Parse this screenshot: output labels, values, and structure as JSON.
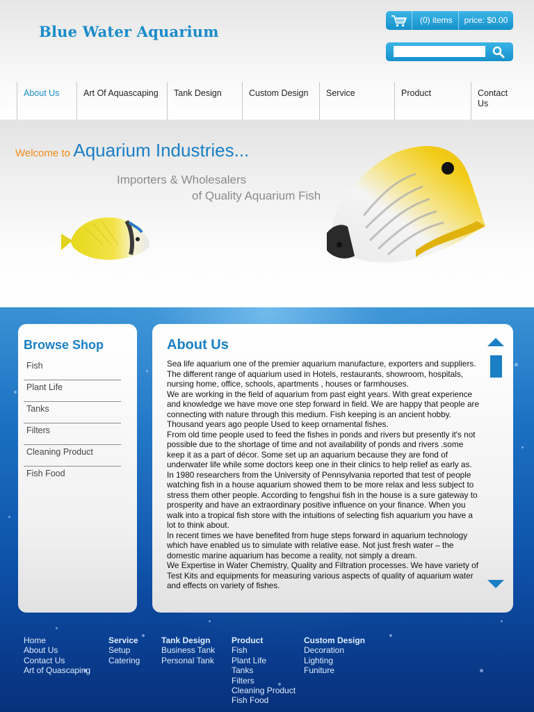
{
  "site": {
    "logo": "Blue Water Aquarium"
  },
  "cart": {
    "items": "(0) items",
    "price": "price: $0.00"
  },
  "search": {
    "placeholder": ""
  },
  "nav": [
    "About Us",
    "Art Of Aquascaping",
    "Tank Design",
    "Custom Design",
    "Service",
    "Product",
    "Contact Us"
  ],
  "banner": {
    "welcome": "Welcome to",
    "company": "Aquarium Industries...",
    "tagline1": "Importers & Wholesalers",
    "tagline2": "of Quality Aquarium Fish"
  },
  "sidebar": {
    "title": "Browse Shop",
    "items": [
      "Fish",
      "Plant Life",
      "Tanks",
      "Filters",
      "Cleaning Product",
      "Fish Food"
    ]
  },
  "about": {
    "title": "About Us",
    "paragraphs": [
      "Sea life aquarium one of the premier aquarium manufacture, exporters and suppliers. The different range of aquarium used in Hotels, restaurants, showroom, hospitals, nursing home, office, schools, apartments , houses or farmhouses.",
      "We are working in the field of aquarium from past eight years. With great experience and knowledge we have move one step forward in field. We are happy that people are connecting with nature through this medium. Fish keeping is an ancient hobby. Thousand years ago people Used to keep ornamental fishes.",
      "From old time people used to feed the fishes in ponds and rivers but presently it's not possible due to the shortage of time and not availability of ponds and rivers .some keep it as a part of décor. Some set up an aquarium because they are fond of underwater life while some doctors keep one in their clinics to help relief as early as. In 1980 researchers from the University of Pennsylvania reported that test of people watching fish in a house aquarium showed them to be more relax and less subject to stress them other people. According to fengshui fish in the house is a sure gateway to prosperity and have an extraordinary positive influence on your finance. When you walk into a tropical fish store with the intuitions of selecting fish aquarium you have a lot to think about.",
      "In recent times we have benefited from huge steps forward in aquarium technology which have enabled us to simulate with relative ease. Not just fresh water – the domestic marine aquarium has become a reality, not simply a dream.",
      "We Expertise in Water Chemistry, Quality and Filtration processes. We have variety of Test Kits and equipments for measuring various aspects of quality of aquarium water and effects on variety of fishes."
    ]
  },
  "footer": {
    "col1": {
      "links": [
        "Home",
        "About Us",
        "Contact Us",
        "Art of Quascaping"
      ]
    },
    "col2": {
      "head": "Service",
      "links": [
        "Setup",
        "Catering"
      ]
    },
    "col3": {
      "head": "Tank Design",
      "links": [
        "Business Tank",
        "Personal Tank"
      ]
    },
    "col4": {
      "head": "Product",
      "links": [
        "Fish",
        "Plant Life",
        "Tanks",
        "Filters",
        "Cleaning Product",
        "Fish Food"
      ]
    },
    "col5": {
      "head": "Custom Design",
      "links": [
        "Decoration",
        "Lighting",
        "Funiture"
      ]
    }
  },
  "colors": {
    "accent": "#1a7fc4",
    "orange": "#f08a1a",
    "button": "#1a99d4"
  }
}
